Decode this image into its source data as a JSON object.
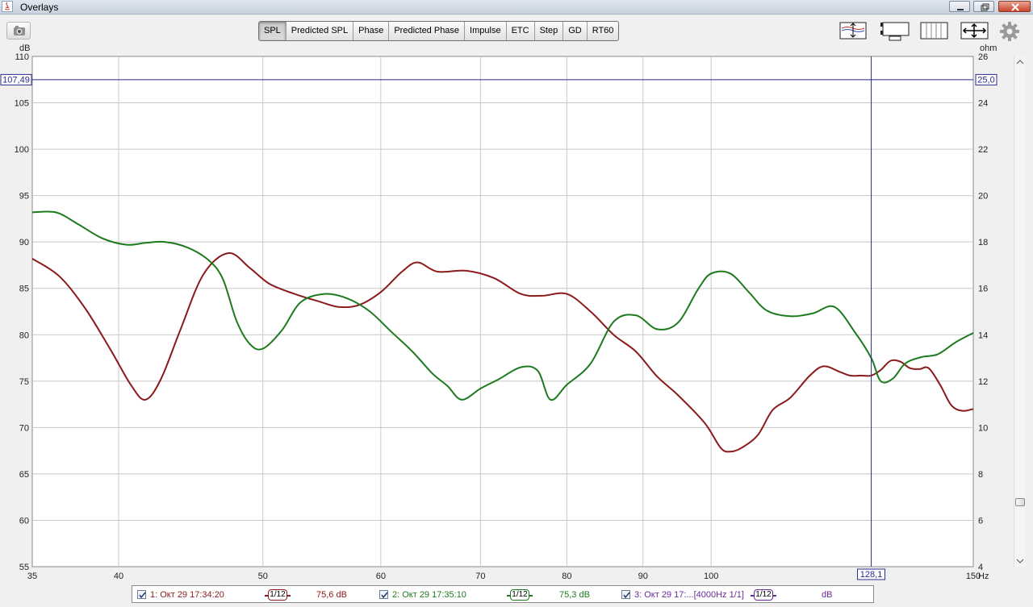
{
  "window": {
    "title": "Overlays"
  },
  "tabs": [
    "SPL",
    "Predicted SPL",
    "Phase",
    "Predicted Phase",
    "Impulse",
    "ETC",
    "Step",
    "GD",
    "RT60"
  ],
  "active_tab": "SPL",
  "cursor": {
    "y_left_label": "107,49",
    "y_right_label": "25,0",
    "x_label": "128,1"
  },
  "chart_data": {
    "type": "line",
    "x_scale": "log",
    "xlim": [
      35,
      150
    ],
    "x_ticks": [
      "35",
      "40",
      "50",
      "60",
      "70",
      "80",
      "90",
      "100",
      "150"
    ],
    "x_unit": "Hz",
    "ylim": [
      55,
      110
    ],
    "y_ticks": [
      "110",
      "105",
      "100",
      "95",
      "90",
      "85",
      "80",
      "75",
      "70",
      "65",
      "60",
      "55"
    ],
    "y_unit": "dB",
    "y2lim": [
      4,
      26
    ],
    "y2_ticks": [
      "26",
      "24",
      "22",
      "20",
      "18",
      "16",
      "14",
      "12",
      "10",
      "8",
      "6",
      "4"
    ],
    "y2_unit": "ohm",
    "cursor_x": 128.1,
    "cursor_y": 107.49,
    "series": [
      {
        "color": "#8b1a1a",
        "x": [
          35,
          36.5,
          38,
          39.5,
          40.8,
          41.7,
          42.7,
          44,
          45.6,
          47.4,
          49,
          50.5,
          52.5,
          54.5,
          56.2,
          58,
          60,
          62,
          63.5,
          65.5,
          68.5,
          71.5,
          74.5,
          77,
          80,
          83,
          86,
          89,
          92,
          95,
          99,
          101.5,
          103,
          104.8,
          107.5,
          110,
          113,
          116.5,
          119,
          122,
          124,
          126,
          128.1,
          130,
          132,
          134,
          136,
          138,
          140,
          142.5,
          145,
          147.5,
          150
        ],
        "y": [
          88.2,
          86.3,
          82.8,
          78.4,
          74.5,
          73.0,
          75.2,
          80.5,
          86.5,
          88.8,
          87.2,
          85.5,
          84.4,
          83.6,
          83.0,
          83.2,
          84.6,
          86.8,
          87.8,
          86.8,
          86.9,
          86.1,
          84.4,
          84.2,
          84.4,
          82.5,
          80.0,
          78.2,
          75.5,
          73.5,
          70.5,
          67.8,
          67.4,
          67.8,
          69.2,
          71.9,
          73.2,
          75.6,
          76.6,
          76.0,
          75.6,
          75.6,
          75.6,
          76.2,
          77.2,
          77.1,
          76.4,
          76.3,
          76.4,
          74.6,
          72.4,
          71.8,
          72.0
        ]
      },
      {
        "color": "#1e7a1e",
        "x": [
          35,
          36.3,
          37.5,
          39,
          40.5,
          41.7,
          43,
          44.5,
          46,
          47,
          48,
          49,
          50,
          51.5,
          53,
          55,
          57,
          59,
          61,
          63,
          65,
          66.5,
          68,
          70,
          72,
          74.5,
          76.5,
          78,
          80,
          83,
          86,
          89,
          92,
          95,
          98,
          100,
          103,
          106,
          109,
          113,
          117,
          121,
          125,
          128.1,
          130,
          132.5,
          135,
          138.5,
          142,
          146,
          150
        ],
        "y": [
          93.2,
          93.2,
          92.0,
          90.4,
          89.7,
          89.9,
          90.0,
          89.4,
          88.0,
          86.0,
          81.5,
          79.0,
          78.5,
          80.5,
          83.5,
          84.4,
          83.9,
          82.5,
          80.3,
          78.2,
          75.8,
          74.5,
          73.0,
          74.2,
          75.2,
          76.5,
          76.1,
          73.0,
          74.6,
          76.9,
          81.4,
          82.1,
          80.6,
          81.3,
          84.9,
          86.6,
          86.6,
          84.6,
          82.6,
          82.0,
          82.3,
          83.0,
          80.2,
          77.5,
          75.0,
          75.3,
          76.9,
          77.6,
          77.9,
          79.2,
          80.2
        ]
      }
    ]
  },
  "legend": [
    {
      "label": "1: Окт 29 17:34:20",
      "smoothing": "1/12",
      "value": "75,6 dB",
      "color": "#8b1a1a"
    },
    {
      "label": "2: Окт 29 17:35:10",
      "smoothing": "1/12",
      "value": "75,3 dB",
      "color": "#1e7a1e"
    },
    {
      "label": "3: Окт 29 17:...[4000Hz 1/1]",
      "smoothing": "1/12",
      "value": "dB",
      "color": "#6a2a9a"
    }
  ],
  "icons": [
    "java-icon",
    "minimize-icon",
    "restore-icon",
    "close-icon",
    "camera-icon",
    "limits-icon",
    "controls-icon",
    "grid-icon",
    "pan-arrows-icon",
    "gear-icon"
  ]
}
